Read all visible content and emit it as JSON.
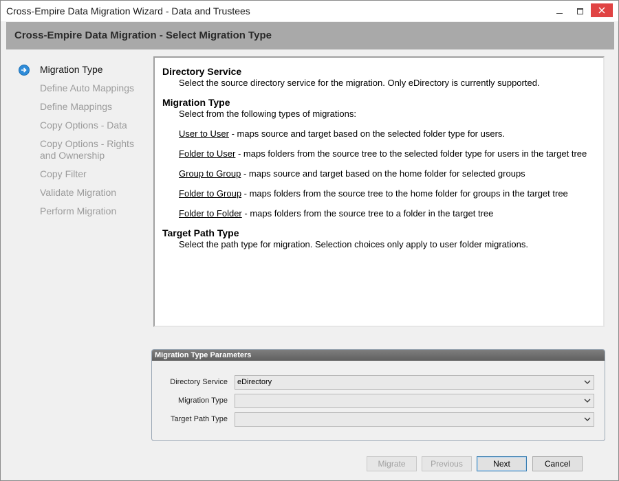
{
  "window": {
    "title": "Cross-Empire Data Migration Wizard  -  Data and Trustees"
  },
  "header": {
    "title": "Cross-Empire Data Migration  -  Select Migration Type"
  },
  "steps": [
    {
      "label": "Migration Type",
      "active": true
    },
    {
      "label": "Define Auto Mappings",
      "active": false
    },
    {
      "label": "Define Mappings",
      "active": false
    },
    {
      "label": "Copy Options - Data",
      "active": false
    },
    {
      "label": "Copy Options - Rights and Ownership",
      "active": false
    },
    {
      "label": "Copy Filter",
      "active": false
    },
    {
      "label": "Validate Migration",
      "active": false
    },
    {
      "label": "Perform Migration",
      "active": false
    }
  ],
  "help": {
    "directory_service": {
      "heading": "Directory Service",
      "text": "Select the source directory service for the migration.  Only eDirectory is currently supported."
    },
    "migration_type": {
      "heading": "Migration Type",
      "intro": "Select from the following types of migrations:",
      "options": [
        {
          "name": "User to User",
          "desc": " - maps source and target based on the selected folder type for users."
        },
        {
          "name": "Folder to User",
          "desc": " - maps folders from the source tree to the selected folder type for users in the target tree"
        },
        {
          "name": "Group to Group",
          "desc": " - maps source and target based on the home folder for selected groups"
        },
        {
          "name": "Folder to Group",
          "desc": " - maps folders from the source tree to the home folder for groups in the target tree"
        },
        {
          "name": "Folder to Folder",
          "desc": " - maps folders from the source tree to a folder in the target tree"
        }
      ]
    },
    "target_path_type": {
      "heading": "Target Path Type",
      "text": "Select the path type for migration.  Selection choices only apply to user folder migrations."
    }
  },
  "params": {
    "title": "Migration Type Parameters",
    "fields": [
      {
        "label": "Directory Service",
        "value": "eDirectory"
      },
      {
        "label": "Migration Type",
        "value": ""
      },
      {
        "label": "Target Path Type",
        "value": ""
      }
    ]
  },
  "buttons": {
    "migrate": "Migrate",
    "previous": "Previous",
    "next": "Next",
    "cancel": "Cancel"
  }
}
